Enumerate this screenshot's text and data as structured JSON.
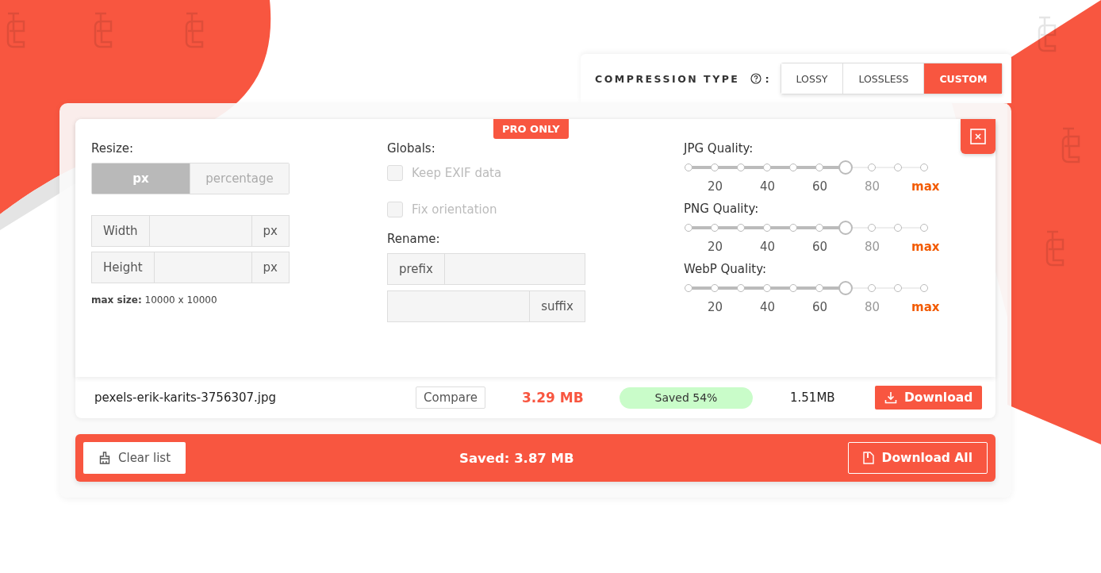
{
  "compression": {
    "label": "COMPRESSION TYPE",
    "suffix": ":",
    "options": [
      {
        "label": "LOSSY",
        "selected": false
      },
      {
        "label": "LOSSLESS",
        "selected": false
      },
      {
        "label": "CUSTOM",
        "selected": true
      }
    ]
  },
  "settings": {
    "badge": "PRO ONLY",
    "resize": {
      "title": "Resize:",
      "modes": [
        {
          "label": "px",
          "selected": true
        },
        {
          "label": "percentage",
          "selected": false
        }
      ],
      "fields": [
        {
          "label": "Width",
          "unit": "px"
        },
        {
          "label": "Height",
          "unit": "px"
        }
      ],
      "note_label": "max size:",
      "note_value": "10000 x 10000"
    },
    "globals": {
      "title": "Globals:",
      "options": [
        {
          "label": "Keep EXIF data",
          "checked": false,
          "disabled": true
        },
        {
          "label": "Fix orientation",
          "checked": false,
          "disabled": true
        }
      ]
    },
    "rename": {
      "title": "Rename:",
      "fields": [
        {
          "label": "prefix",
          "kind": "leading"
        },
        {
          "label": "suffix",
          "kind": "trailing"
        }
      ]
    },
    "quality": [
      {
        "title": "JPG Quality:",
        "level": 0.667,
        "ticks": [
          {
            "label": "20",
            "kind": "step"
          },
          {
            "label": "40",
            "kind": "step"
          },
          {
            "label": "60",
            "kind": "step"
          },
          {
            "label": "80",
            "kind": "step"
          },
          {
            "label": "max",
            "kind": "max"
          }
        ]
      },
      {
        "title": "PNG Quality:",
        "level": 0.667,
        "ticks": [
          {
            "label": "20",
            "kind": "step"
          },
          {
            "label": "40",
            "kind": "step"
          },
          {
            "label": "60",
            "kind": "step"
          },
          {
            "label": "80",
            "kind": "step"
          },
          {
            "label": "max",
            "kind": "max"
          }
        ]
      },
      {
        "title": "WebP Quality:",
        "level": 0.667,
        "ticks": [
          {
            "label": "20",
            "kind": "step"
          },
          {
            "label": "40",
            "kind": "step"
          },
          {
            "label": "60",
            "kind": "step"
          },
          {
            "label": "80",
            "kind": "step"
          },
          {
            "label": "max",
            "kind": "max"
          }
        ]
      }
    ]
  },
  "files": [
    {
      "name": "pexels-erik-karits-3756307.jpg",
      "compare": "Compare",
      "before": "3.29 MB",
      "status": "Saved 54%",
      "after": "1.51MB",
      "action": "Download"
    }
  ],
  "footer": {
    "clear": "Clear list",
    "saved": "Saved: 3.87 MB",
    "download_all": "Download All"
  }
}
